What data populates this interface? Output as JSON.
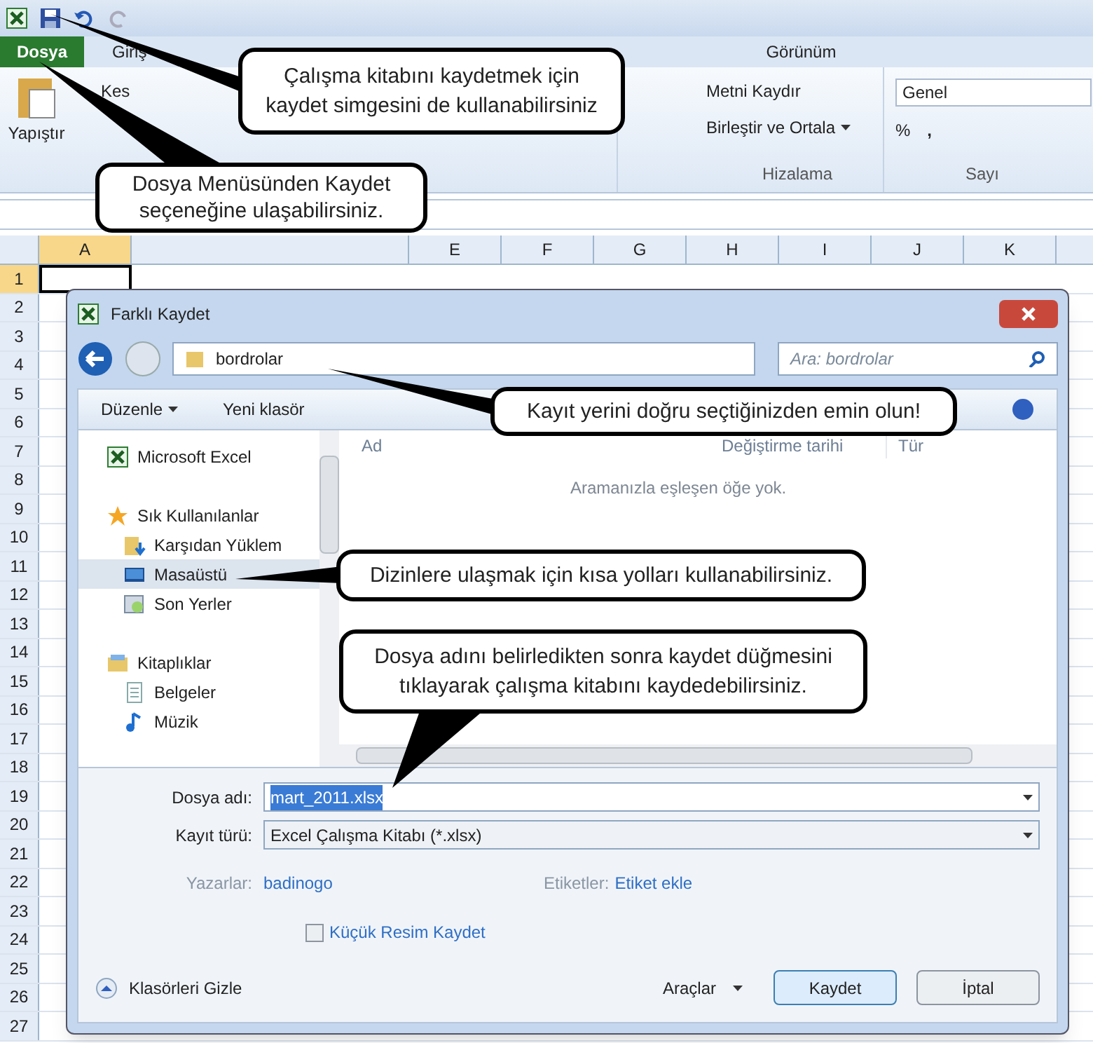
{
  "ribbon": {
    "tabs": [
      {
        "label": "Dosya",
        "selected": true
      },
      {
        "label": "Giriş",
        "selected": false
      },
      {
        "label": "Görünüm",
        "selected": false
      }
    ],
    "clipboard": {
      "paste": "Yapıştır",
      "cut": "Kes"
    },
    "alignment": {
      "wrap": "Metni Kaydır",
      "merge": "Birleştir ve Ortala",
      "group": "Hizalama"
    },
    "number": {
      "format": "Genel",
      "percent": "%",
      "comma": ",",
      "group": "Sayı"
    }
  },
  "sheet": {
    "columns": [
      "A",
      "E",
      "F",
      "G",
      "H",
      "I",
      "J",
      "K"
    ],
    "rows": [
      "1",
      "2",
      "3",
      "4",
      "5",
      "6",
      "7",
      "8",
      "9",
      "10",
      "11",
      "12",
      "13",
      "14",
      "15",
      "16",
      "17",
      "18",
      "19",
      "20",
      "21",
      "22",
      "23",
      "24",
      "25",
      "26",
      "27"
    ]
  },
  "dialog": {
    "title": "Farklı Kaydet",
    "address": "bordrolar",
    "search": {
      "placeholder": "Ara: bordrolar"
    },
    "toolbar": {
      "organize": "Düzenle",
      "new_folder": "Yeni klasör"
    },
    "nav": [
      {
        "label": "Microsoft Excel",
        "kind": "excel",
        "selected": false
      },
      {
        "label": "Sık Kullanılanlar",
        "kind": "star",
        "selected": false,
        "children": [
          {
            "label": "Karşıdan Yüklem",
            "kind": "download",
            "selected": false
          },
          {
            "label": "Masaüstü",
            "kind": "desktop",
            "selected": true
          },
          {
            "label": "Son Yerler",
            "kind": "recent",
            "selected": false
          }
        ]
      },
      {
        "label": "Kitaplıklar",
        "kind": "library",
        "selected": false,
        "children": [
          {
            "label": "Belgeler",
            "kind": "document",
            "selected": false
          },
          {
            "label": "Müzik",
            "kind": "music",
            "selected": false
          }
        ]
      }
    ],
    "list_columns": [
      "Ad",
      "Değiştirme tarihi",
      "Tür"
    ],
    "empty_message": "Aramanızla eşleşen öğe yok.",
    "file_name": {
      "label": "Dosya adı:",
      "value": "mart_2011.xlsx"
    },
    "file_type": {
      "label": "Kayıt türü:",
      "value": "Excel Çalışma Kitabı (*.xlsx)"
    },
    "authors": {
      "label": "Yazarlar:",
      "value": "badinogo"
    },
    "tags": {
      "label": "Etiketler:",
      "value": "Etiket ekle"
    },
    "thumbnail": {
      "label": "Küçük Resim Kaydet",
      "checked": false
    },
    "hide_folders": "Klasörleri Gizle",
    "tools": "Araçlar",
    "save": "Kaydet",
    "cancel": "İptal"
  },
  "callouts": [
    {
      "text": "Çalışma kitabını kaydetmek için kaydet simgesini de kullanabilirsiniz"
    },
    {
      "text": "Dosya Menüsünden Kaydet seçeneğine ulaşabilirsiniz."
    },
    {
      "text": "Kayıt yerini doğru seçtiğinizden emin olun!"
    },
    {
      "text": "Dizinlere ulaşmak için kısa yolları kullanabilirsiniz."
    },
    {
      "text": "Dosya adını belirledikten sonra kaydet düğmesini tıklayarak çalışma kitabını kaydedebilirsiniz."
    }
  ]
}
